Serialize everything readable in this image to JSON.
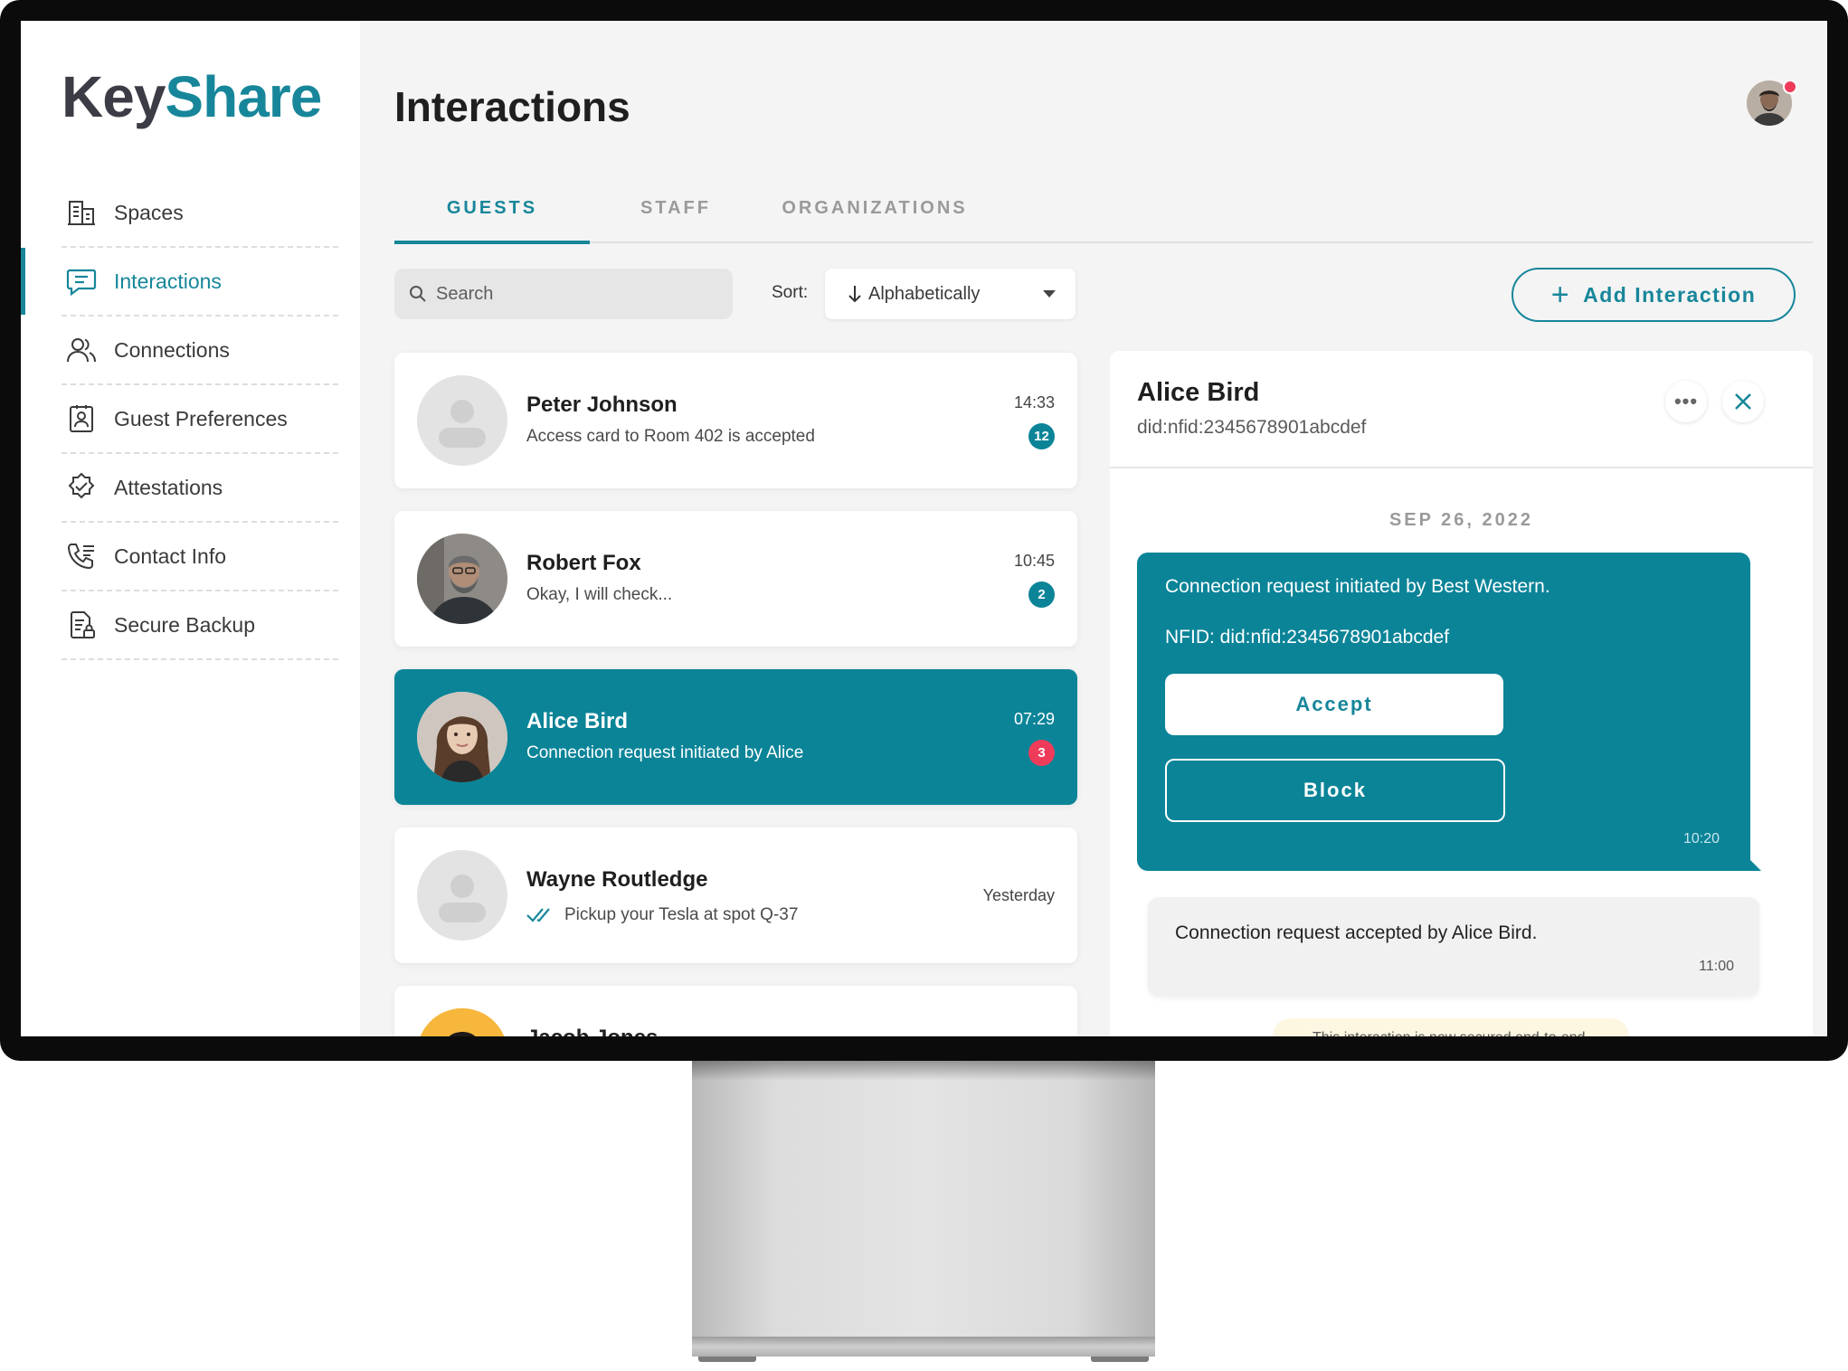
{
  "app": {
    "logo_part1": "Key",
    "logo_part2": "Share",
    "brand_color": "#17869a",
    "accent_red": "#ef3b5a"
  },
  "sidebar": {
    "items": [
      {
        "label": "Spaces",
        "icon": "building-icon"
      },
      {
        "label": "Interactions",
        "icon": "chat-icon",
        "active": true
      },
      {
        "label": "Connections",
        "icon": "users-icon"
      },
      {
        "label": "Guest Preferences",
        "icon": "contact-card-icon"
      },
      {
        "label": "Attestations",
        "icon": "verified-badge-icon"
      },
      {
        "label": "Contact Info",
        "icon": "phone-icon"
      },
      {
        "label": "Secure Backup",
        "icon": "backup-lock-icon"
      }
    ]
  },
  "header": {
    "title": "Interactions"
  },
  "tabs": [
    {
      "label": "GUESTS",
      "active": true
    },
    {
      "label": "STAFF"
    },
    {
      "label": "ORGANIZATIONS"
    }
  ],
  "toolbar": {
    "search_placeholder": "Search",
    "sort_label": "Sort:",
    "sort_value": "Alphabetically",
    "add_label": "Add Interaction"
  },
  "list": [
    {
      "name": "Peter Johnson",
      "message": "Access card to Room 402 is accepted",
      "time": "14:33",
      "badge": "12"
    },
    {
      "name": "Robert Fox",
      "message": "Okay, I will check...",
      "time": "10:45",
      "badge": "2"
    },
    {
      "name": "Alice Bird",
      "message": "Connection request initiated by Alice",
      "time": "07:29",
      "badge": "3",
      "active": true
    },
    {
      "name": "Wayne Routledge",
      "message": "Pickup your Tesla at spot Q-37",
      "time": "Yesterday",
      "read": true
    },
    {
      "name": "Jacob Jones",
      "message": "",
      "time": ""
    }
  ],
  "detail": {
    "name": "Alice Bird",
    "did": "did:nfid:2345678901abcdef",
    "date": "SEP 26, 2022",
    "request": {
      "line1": "Connection request initiated by Best Western.",
      "line2": "NFID: did:nfid:2345678901abcdef",
      "accept_label": "Accept",
      "block_label": "Block",
      "time": "10:20"
    },
    "reply": {
      "text": "Connection request accepted by Alice Bird.",
      "time": "11:00"
    },
    "notice": "This interaction is now secured end-to-end."
  }
}
